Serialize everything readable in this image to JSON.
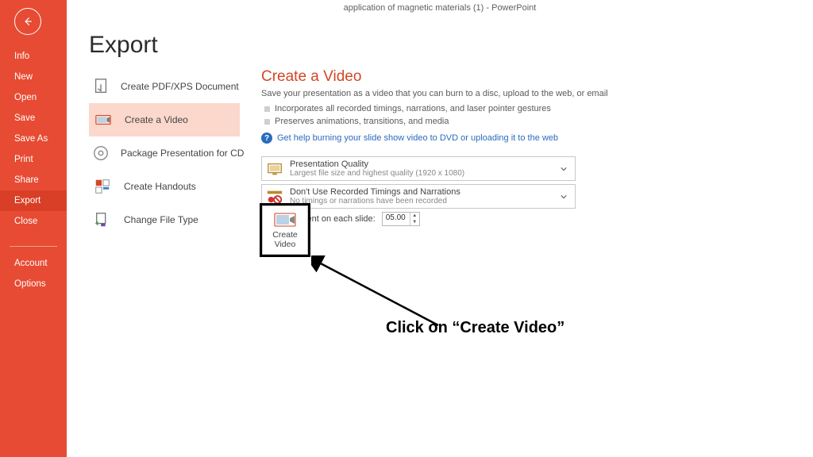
{
  "app_title": "application of magnetic materials (1) - PowerPoint",
  "sidebar": {
    "items": [
      {
        "label": "Info"
      },
      {
        "label": "New"
      },
      {
        "label": "Open"
      },
      {
        "label": "Save"
      },
      {
        "label": "Save As"
      },
      {
        "label": "Print"
      },
      {
        "label": "Share"
      },
      {
        "label": "Export"
      },
      {
        "label": "Close"
      }
    ],
    "bottom": [
      {
        "label": "Account"
      },
      {
        "label": "Options"
      }
    ],
    "selected_index": 7
  },
  "heading": "Export",
  "options": [
    {
      "label": "Create PDF/XPS Document"
    },
    {
      "label": "Create a Video"
    },
    {
      "label": "Package Presentation for CD"
    },
    {
      "label": "Create Handouts"
    },
    {
      "label": "Change File Type"
    }
  ],
  "options_selected_index": 1,
  "detail": {
    "title": "Create a Video",
    "subtitle": "Save your presentation as a video that you can burn to a disc, upload to the web, or email",
    "bullets": [
      "Incorporates all recorded timings, narrations, and laser pointer gestures",
      "Preserves animations, transitions, and media"
    ],
    "help_text": "Get help burning your slide show video to DVD or uploading it to the web",
    "quality": {
      "line1": "Presentation Quality",
      "line2": "Largest file size and highest quality (1920 x 1080)"
    },
    "timings": {
      "line1": "Don't Use Recorded Timings and Narrations",
      "line2": "No timings or narrations have been recorded"
    },
    "seconds_label": "Seconds spent on each slide:",
    "seconds_value": "05.00",
    "button_label": "Create\nVideo"
  },
  "annotation": "Click on “Create Video”"
}
